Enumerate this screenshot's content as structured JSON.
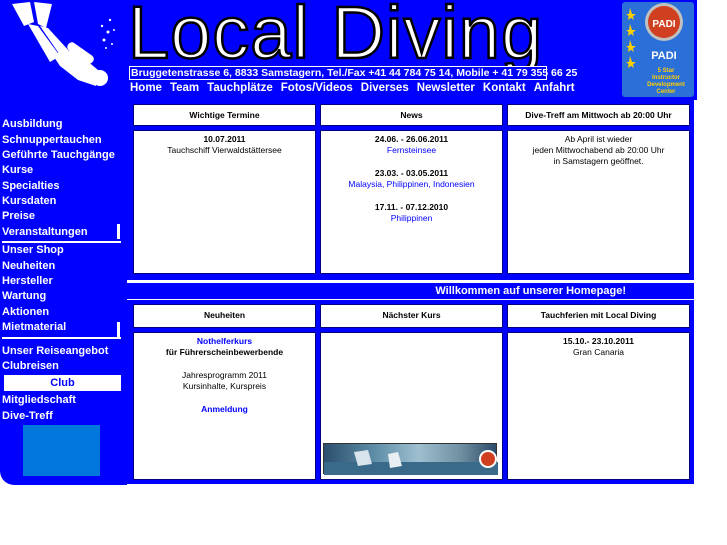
{
  "header": {
    "title": "Local Diving",
    "address": "Bruggetenstrasse 6, 8833 Samstagern, Tel./Fax +41 44 784 75 14, Mobile + 41 79 355 66 25",
    "padi_badge_lines": [
      "5 Star",
      "Instructor",
      "Development",
      "Center"
    ],
    "padi_text": "PADI"
  },
  "topnav": [
    "Home",
    "Team",
    "Tauchplätze",
    "Fotos/Videos",
    "Diverses",
    "Newsletter",
    "Kontakt",
    "Anfahrt"
  ],
  "leftnav": {
    "items": [
      "Ausbildung",
      "Schnuppertauchen",
      "Geführte Tauchgänge",
      "Kurse",
      "Specialties",
      "Kursdaten",
      "Preise",
      "Veranstaltungen",
      "Unser Shop",
      "Neuheiten",
      "Hersteller",
      "Wartung",
      "Aktionen",
      "Mietmaterial",
      "Unser Reiseangebot",
      "Clubreisen"
    ],
    "club_label": "Club",
    "club_items": [
      "Mitgliedschaft",
      "Dive-Treff"
    ]
  },
  "panel1": {
    "col1": {
      "header": "Wichtige Termine",
      "date": "10.07.2011",
      "text": "Tauchschiff Vierwaldstättersee"
    },
    "col2": {
      "header": "News",
      "entries": [
        {
          "date": "24.06. - 26.06.2011",
          "place": "Fernsteinsee"
        },
        {
          "date": "23.03. - 03.05.2011",
          "place": "Malaysia, Philippinen, Indonesien"
        },
        {
          "date": "17.11. - 07.12.2010",
          "place": "Philippinen"
        }
      ]
    },
    "col3": {
      "header": "Dive-Treff am Mittwoch ab 20:00 Uhr",
      "lines": [
        "Ab April ist wieder",
        "jeden Mittwochabend ab 20:00 Uhr",
        "in Samstagern geöffnet."
      ]
    }
  },
  "welcome": "Willkommen auf unserer Homepage!",
  "panel2": {
    "col1": {
      "header": "Neuheiten",
      "link1": "Nothelferkurs",
      "line2": "für Führerscheinbewerbende",
      "line3": "Jahresprogramm 2011",
      "line4": "Kursinhalte, Kurspreis",
      "link2": "Anmeldung"
    },
    "col2": {
      "header": "Nächster Kurs"
    },
    "col3": {
      "header": "Tauchferien mit Local Diving",
      "date": "15.10.- 23.10.2011",
      "place": "Gran Canaria"
    }
  }
}
